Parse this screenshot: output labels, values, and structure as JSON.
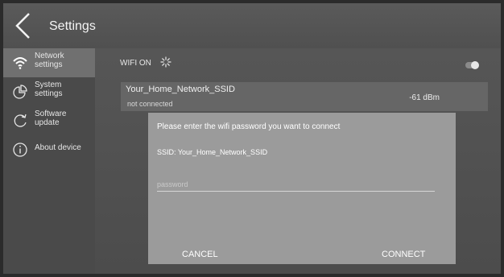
{
  "header": {
    "title": "Settings",
    "back_icon": "chevron-left-icon"
  },
  "sidebar": {
    "items": [
      {
        "label_line1": "Network",
        "label_line2": "settings",
        "icon": "wifi-icon",
        "active": true
      },
      {
        "label_line1": "System",
        "label_line2": "settings",
        "icon": "pie-chart-icon",
        "active": false
      },
      {
        "label_line1": "Software",
        "label_line2": "update",
        "icon": "refresh-icon",
        "active": false
      },
      {
        "label_line1": "About device",
        "label_line2": "",
        "icon": "info-icon",
        "active": false
      }
    ]
  },
  "wifi": {
    "label": "WIFI ON",
    "toggle_on": true,
    "network": {
      "ssid": "Your_Home_Network_SSID",
      "status": "not connected",
      "signal": "-61 dBm"
    }
  },
  "dialog": {
    "title": "Please enter the wifi password you want to connect",
    "ssid_line": "SSID: Your_Home_Network_SSID",
    "password_placeholder": "password",
    "cancel_label": "CANCEL",
    "connect_label": "CONNECT"
  },
  "colors": {
    "background": "#4d4d4d",
    "active_item": "#707070",
    "dialog": "#9b9b9b"
  }
}
